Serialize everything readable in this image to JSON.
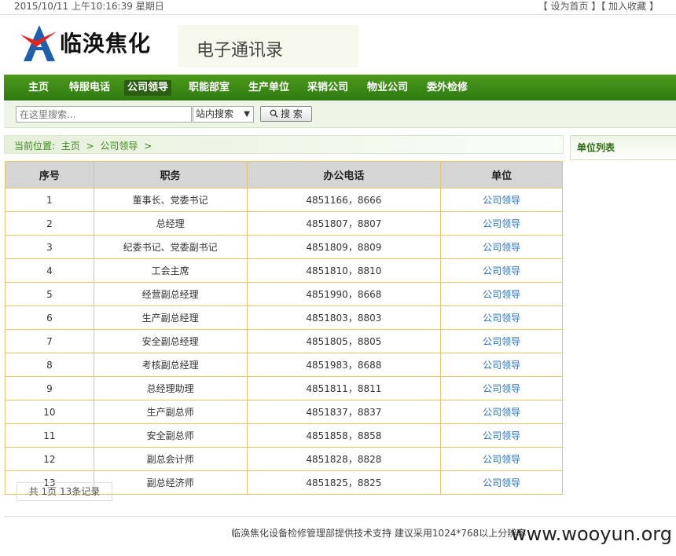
{
  "topbar": {
    "date": "2015/10/11 上午10:16:39 星期日",
    "set_home": "【 设为首页 】",
    "add_fav": "【 加入收藏 】"
  },
  "header": {
    "logo_text": "临涣焦化",
    "title": "电子通讯录",
    "brand_colors": {
      "blue": "#1f5fb0",
      "red": "#e0261c"
    }
  },
  "nav": {
    "items": [
      "主页",
      "特服电话",
      "公司领导",
      "职能部室",
      "生产单位",
      "采销公司",
      "物业公司",
      "委外检修"
    ],
    "active_index": 2
  },
  "search": {
    "placeholder": "在这里搜索...",
    "scope": "站内搜索",
    "button": "搜 索"
  },
  "breadcrumb": {
    "label": "当前位置:",
    "home": "主页",
    "current": "公司领导",
    "sep": ">"
  },
  "sidebar": {
    "title": "单位列表"
  },
  "table": {
    "headers": [
      "序号",
      "职务",
      "办公电话",
      "单位"
    ],
    "rows": [
      [
        "1",
        "董事长、党委书记",
        "4851166，8666",
        "公司领导"
      ],
      [
        "2",
        "总经理",
        "4851807，8807",
        "公司领导"
      ],
      [
        "3",
        "纪委书记、党委副书记",
        "4851809，8809",
        "公司领导"
      ],
      [
        "4",
        "工会主席",
        "4851810，8810",
        "公司领导"
      ],
      [
        "5",
        "经营副总经理",
        "4851990，8668",
        "公司领导"
      ],
      [
        "6",
        "生产副总经理",
        "4851803，8803",
        "公司领导"
      ],
      [
        "7",
        "安全副总经理",
        "4851805，8805",
        "公司领导"
      ],
      [
        "8",
        "考核副总经理",
        "4851983，8688",
        "公司领导"
      ],
      [
        "9",
        "总经理助理",
        "4851811，8811",
        "公司领导"
      ],
      [
        "10",
        "生产副总师",
        "4851837，8837",
        "公司领导"
      ],
      [
        "11",
        "安全副总师",
        "4851858，8858",
        "公司领导"
      ],
      [
        "12",
        "副总会计师",
        "4851828，8828",
        "公司领导"
      ],
      [
        "13",
        "副总经济师",
        "4851825，8825",
        "公司领导"
      ]
    ]
  },
  "pager": {
    "text": "共 1页 13条记录"
  },
  "footer": {
    "text": "临涣焦化设备检修管理部提供技术支持 建议采用1024*768以上分辨率",
    "watermark": "www.wooyun.org"
  }
}
